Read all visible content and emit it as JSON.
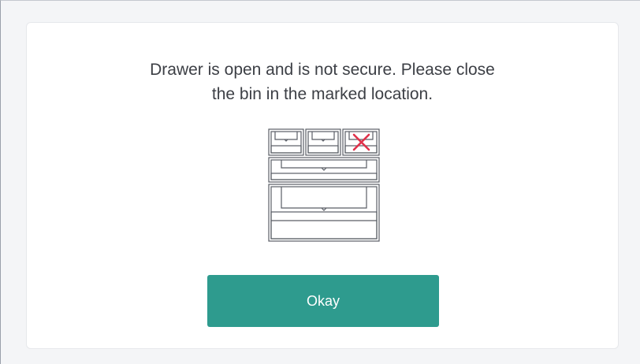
{
  "dialog": {
    "message_line1": "Drawer is open and is not secure. Please close",
    "message_line2": "the bin in the marked location.",
    "diagram_icon": "drawer-cabinet-icon",
    "marker_icon": "x-mark-icon",
    "marked_bin": "top row, right bin",
    "okay_label": "Okay"
  },
  "colors": {
    "background": "#f4f5f7",
    "card": "#ffffff",
    "text": "#3c3f45",
    "button": "#2e9b8e",
    "button_text": "#ffffff",
    "marker": "#e0314a",
    "diagram_stroke": "#5a5e66"
  }
}
